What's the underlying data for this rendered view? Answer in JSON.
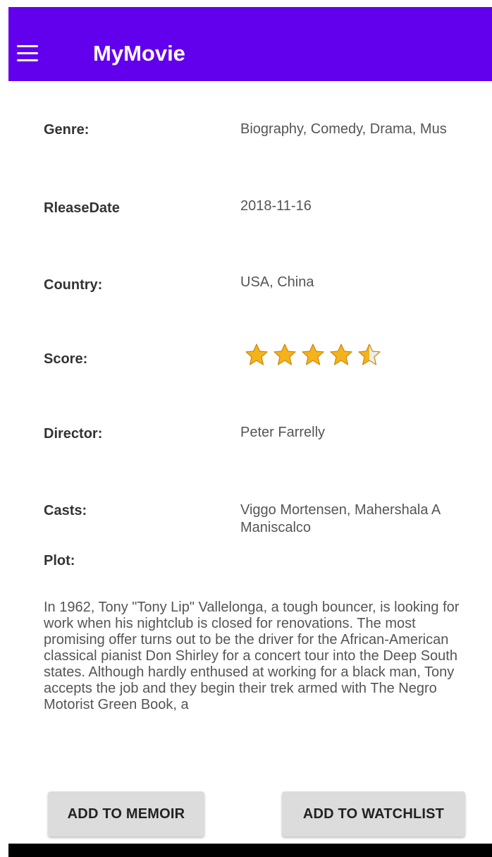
{
  "app_bar": {
    "title": "MyMovie",
    "menu_icon": "hamburger-menu-icon",
    "color": "#6200ee"
  },
  "details": {
    "genre": {
      "label": "Genre:",
      "value": "Biography, Comedy, Drama, Mus"
    },
    "release_date": {
      "label": "RleaseDate",
      "value": "2018-11-16"
    },
    "country": {
      "label": "Country:",
      "value": "USA, China"
    },
    "score": {
      "label": "Score:",
      "rating": 4.5,
      "max": 5
    },
    "director": {
      "label": "Director:",
      "value": "Peter Farrelly"
    },
    "casts": {
      "label": "Casts:",
      "value_line1": "Viggo Mortensen, Mahershala A",
      "value_line2": "Maniscalco"
    },
    "plot": {
      "label": "Plot:",
      "text": "In 1962, Tony \"Tony Lip\" Vallelonga, a tough bouncer, is looking for work when his nightclub is closed for renovations. The most promising offer turns out to be the driver for the African-American classical pianist Don Shirley for a concert tour into the Deep South states. Although hardly enthused at working for a black man, Tony accepts the job and they begin their trek armed with The Negro Motorist Green Book, a"
    }
  },
  "actions": {
    "add_memoir": "ADD TO MEMOIR",
    "add_watchlist": "ADD TO WATCHLIST"
  }
}
